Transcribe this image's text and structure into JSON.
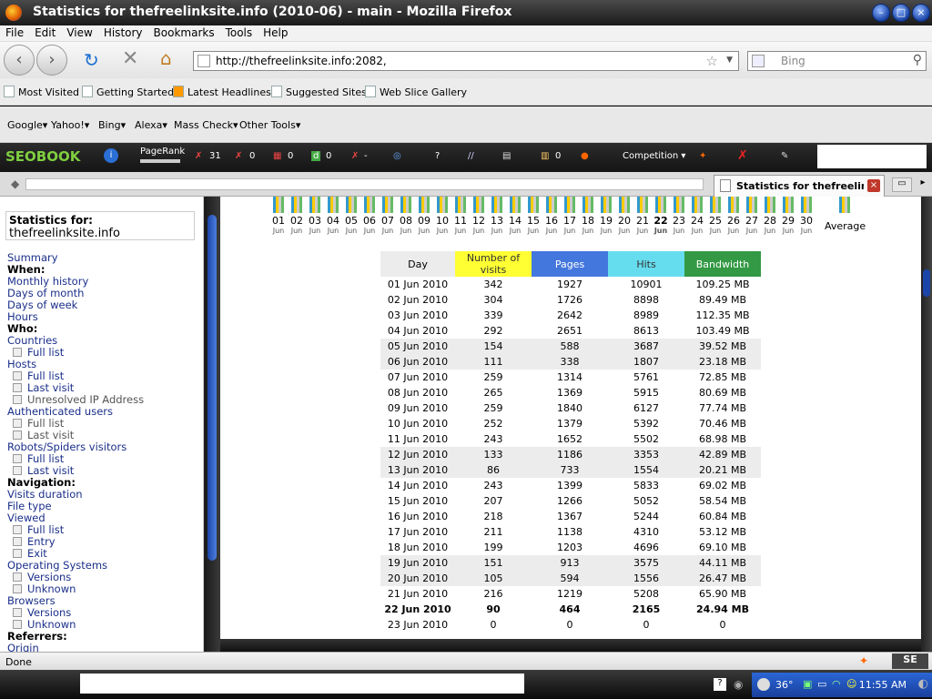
{
  "window": {
    "title": "Statistics for thefreelinksite.info (2010-06) - main - Mozilla Firefox"
  },
  "menu": [
    "File",
    "Edit",
    "View",
    "History",
    "Bookmarks",
    "Tools",
    "Help"
  ],
  "nav": {
    "url": "http://thefreelinksite.info:2082,",
    "search_placeholder": "Bing"
  },
  "bookmarks": [
    "Most Visited",
    "Getting Started",
    "Latest Headlines",
    "Suggested Sites",
    "Web Slice Gallery"
  ],
  "toolbar2": [
    "Google",
    "Yahoo!",
    "Bing",
    "Alexa",
    "Mass Check",
    "Other Tools"
  ],
  "seobar": {
    "logo": "SEOBOOK",
    "pagerank": "PageRank",
    "v1": "31",
    "v2": "0",
    "v3": "0",
    "v4": "0",
    "v5": "-",
    "q": "?",
    "v6": "0",
    "competition": "Competition"
  },
  "tab": {
    "label": "Statistics for thefreelin...",
    "close": "×"
  },
  "sidebar": {
    "stat_heading": "Statistics for:",
    "stat_site": "thefreelinksite.info",
    "items": [
      {
        "label": "Summary",
        "kind": "link"
      },
      {
        "label": "When:",
        "kind": "bold"
      },
      {
        "label": "Monthly history",
        "kind": "link"
      },
      {
        "label": "Days of month",
        "kind": "link"
      },
      {
        "label": "Days of week",
        "kind": "link"
      },
      {
        "label": "Hours",
        "kind": "link"
      },
      {
        "label": "Who:",
        "kind": "bold"
      },
      {
        "label": "Countries",
        "kind": "link"
      },
      {
        "label": "Full list",
        "kind": "sub"
      },
      {
        "label": "Hosts",
        "kind": "link"
      },
      {
        "label": "Full list",
        "kind": "sub"
      },
      {
        "label": "Last visit",
        "kind": "sub"
      },
      {
        "label": "Unresolved IP Address",
        "kind": "subg"
      },
      {
        "label": "Authenticated users",
        "kind": "link"
      },
      {
        "label": "Full list",
        "kind": "subg"
      },
      {
        "label": "Last visit",
        "kind": "subg"
      },
      {
        "label": "Robots/Spiders visitors",
        "kind": "link"
      },
      {
        "label": "Full list",
        "kind": "sub"
      },
      {
        "label": "Last visit",
        "kind": "sub"
      },
      {
        "label": "Navigation:",
        "kind": "bold"
      },
      {
        "label": "Visits duration",
        "kind": "link"
      },
      {
        "label": "File type",
        "kind": "link"
      },
      {
        "label": "Viewed",
        "kind": "link"
      },
      {
        "label": "Full list",
        "kind": "sub"
      },
      {
        "label": "Entry",
        "kind": "sub"
      },
      {
        "label": "Exit",
        "kind": "sub"
      },
      {
        "label": "Operating Systems",
        "kind": "link"
      },
      {
        "label": "Versions",
        "kind": "sub"
      },
      {
        "label": "Unknown",
        "kind": "sub"
      },
      {
        "label": "Browsers",
        "kind": "link"
      },
      {
        "label": "Versions",
        "kind": "sub"
      },
      {
        "label": "Unknown",
        "kind": "sub"
      },
      {
        "label": "Referrers:",
        "kind": "bold"
      },
      {
        "label": "Origin",
        "kind": "link"
      }
    ]
  },
  "days_axis": {
    "days": [
      "01",
      "02",
      "03",
      "04",
      "05",
      "06",
      "07",
      "08",
      "09",
      "10",
      "11",
      "12",
      "13",
      "14",
      "15",
      "16",
      "17",
      "18",
      "19",
      "20",
      "21",
      "22",
      "23",
      "24",
      "25",
      "26",
      "27",
      "28",
      "29",
      "30"
    ],
    "month": "Jun",
    "average_label": "Average"
  },
  "table": {
    "headers": {
      "day": "Day",
      "visits": "Number of visits",
      "pages": "Pages",
      "hits": "Hits",
      "bandwidth": "Bandwidth"
    },
    "rows": [
      {
        "day": "01 Jun 2010",
        "visits": "342",
        "pages": "1927",
        "hits": "10901",
        "bw": "109.25 MB",
        "style": ""
      },
      {
        "day": "02 Jun 2010",
        "visits": "304",
        "pages": "1726",
        "hits": "8898",
        "bw": "89.49 MB",
        "style": ""
      },
      {
        "day": "03 Jun 2010",
        "visits": "339",
        "pages": "2642",
        "hits": "8989",
        "bw": "112.35 MB",
        "style": ""
      },
      {
        "day": "04 Jun 2010",
        "visits": "292",
        "pages": "2651",
        "hits": "8613",
        "bw": "103.49 MB",
        "style": ""
      },
      {
        "day": "05 Jun 2010",
        "visits": "154",
        "pages": "588",
        "hits": "3687",
        "bw": "39.52 MB",
        "style": "wk"
      },
      {
        "day": "06 Jun 2010",
        "visits": "111",
        "pages": "338",
        "hits": "1807",
        "bw": "23.18 MB",
        "style": "wk"
      },
      {
        "day": "07 Jun 2010",
        "visits": "259",
        "pages": "1314",
        "hits": "5761",
        "bw": "72.85 MB",
        "style": ""
      },
      {
        "day": "08 Jun 2010",
        "visits": "265",
        "pages": "1369",
        "hits": "5915",
        "bw": "80.69 MB",
        "style": ""
      },
      {
        "day": "09 Jun 2010",
        "visits": "259",
        "pages": "1840",
        "hits": "6127",
        "bw": "77.74 MB",
        "style": ""
      },
      {
        "day": "10 Jun 2010",
        "visits": "252",
        "pages": "1379",
        "hits": "5392",
        "bw": "70.46 MB",
        "style": ""
      },
      {
        "day": "11 Jun 2010",
        "visits": "243",
        "pages": "1652",
        "hits": "5502",
        "bw": "68.98 MB",
        "style": ""
      },
      {
        "day": "12 Jun 2010",
        "visits": "133",
        "pages": "1186",
        "hits": "3353",
        "bw": "42.89 MB",
        "style": "wk"
      },
      {
        "day": "13 Jun 2010",
        "visits": "86",
        "pages": "733",
        "hits": "1554",
        "bw": "20.21 MB",
        "style": "wk"
      },
      {
        "day": "14 Jun 2010",
        "visits": "243",
        "pages": "1399",
        "hits": "5833",
        "bw": "69.02 MB",
        "style": ""
      },
      {
        "day": "15 Jun 2010",
        "visits": "207",
        "pages": "1266",
        "hits": "5052",
        "bw": "58.54 MB",
        "style": ""
      },
      {
        "day": "16 Jun 2010",
        "visits": "218",
        "pages": "1367",
        "hits": "5244",
        "bw": "60.84 MB",
        "style": ""
      },
      {
        "day": "17 Jun 2010",
        "visits": "211",
        "pages": "1138",
        "hits": "4310",
        "bw": "53.12 MB",
        "style": ""
      },
      {
        "day": "18 Jun 2010",
        "visits": "199",
        "pages": "1203",
        "hits": "4696",
        "bw": "69.10 MB",
        "style": ""
      },
      {
        "day": "19 Jun 2010",
        "visits": "151",
        "pages": "913",
        "hits": "3575",
        "bw": "44.11 MB",
        "style": "wk"
      },
      {
        "day": "20 Jun 2010",
        "visits": "105",
        "pages": "594",
        "hits": "1556",
        "bw": "26.47 MB",
        "style": "wk"
      },
      {
        "day": "21 Jun 2010",
        "visits": "216",
        "pages": "1219",
        "hits": "5208",
        "bw": "65.90 MB",
        "style": ""
      },
      {
        "day": "22 Jun 2010",
        "visits": "90",
        "pages": "464",
        "hits": "2165",
        "bw": "24.94 MB",
        "style": "today"
      },
      {
        "day": "23 Jun 2010",
        "visits": "0",
        "pages": "0",
        "hits": "0",
        "bw": "0",
        "style": ""
      }
    ]
  },
  "status": {
    "text": "Done"
  },
  "taskbar": {
    "temp": "36°",
    "time": "11:55 AM"
  }
}
